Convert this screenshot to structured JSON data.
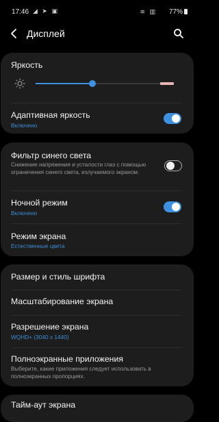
{
  "status_bar": {
    "time": "17:46",
    "left_icons": "◢ ➤ ▣",
    "right_icons": "≋ ▥",
    "battery": "77%"
  },
  "header": {
    "title": "Дисплей"
  },
  "brightness": {
    "title": "Яркость",
    "level_fraction": 0.41
  },
  "items": {
    "adaptive": {
      "title": "Адаптивная яркость",
      "status": "Включено",
      "on": true
    },
    "blue_filter": {
      "title": "Фильтр синего света",
      "description": "Снижение напряжения и усталости глаз с помощью ограничения синего света, излучаемого экраном.",
      "on": false
    },
    "night_mode": {
      "title": "Ночной режим",
      "status": "Включено",
      "on": true
    },
    "screen_mode": {
      "title": "Режим экрана",
      "status": "Естественные цвета"
    },
    "font": {
      "title": "Размер и стиль шрифта"
    },
    "zoom": {
      "title": "Масштабирование экрана"
    },
    "resolution": {
      "title": "Разрешение экрана",
      "status": "WQHD+ (3040 x 1440)"
    },
    "fullscreen": {
      "title": "Полноэкранные приложения",
      "description": "Выберите, какие приложения следует использовать в полноэкранных пропорциях."
    },
    "timeout": {
      "title": "Тайм-аут экрана"
    }
  },
  "colors": {
    "accent": "#3e91e0",
    "card": "#1d1d1d",
    "background": "#000000"
  }
}
